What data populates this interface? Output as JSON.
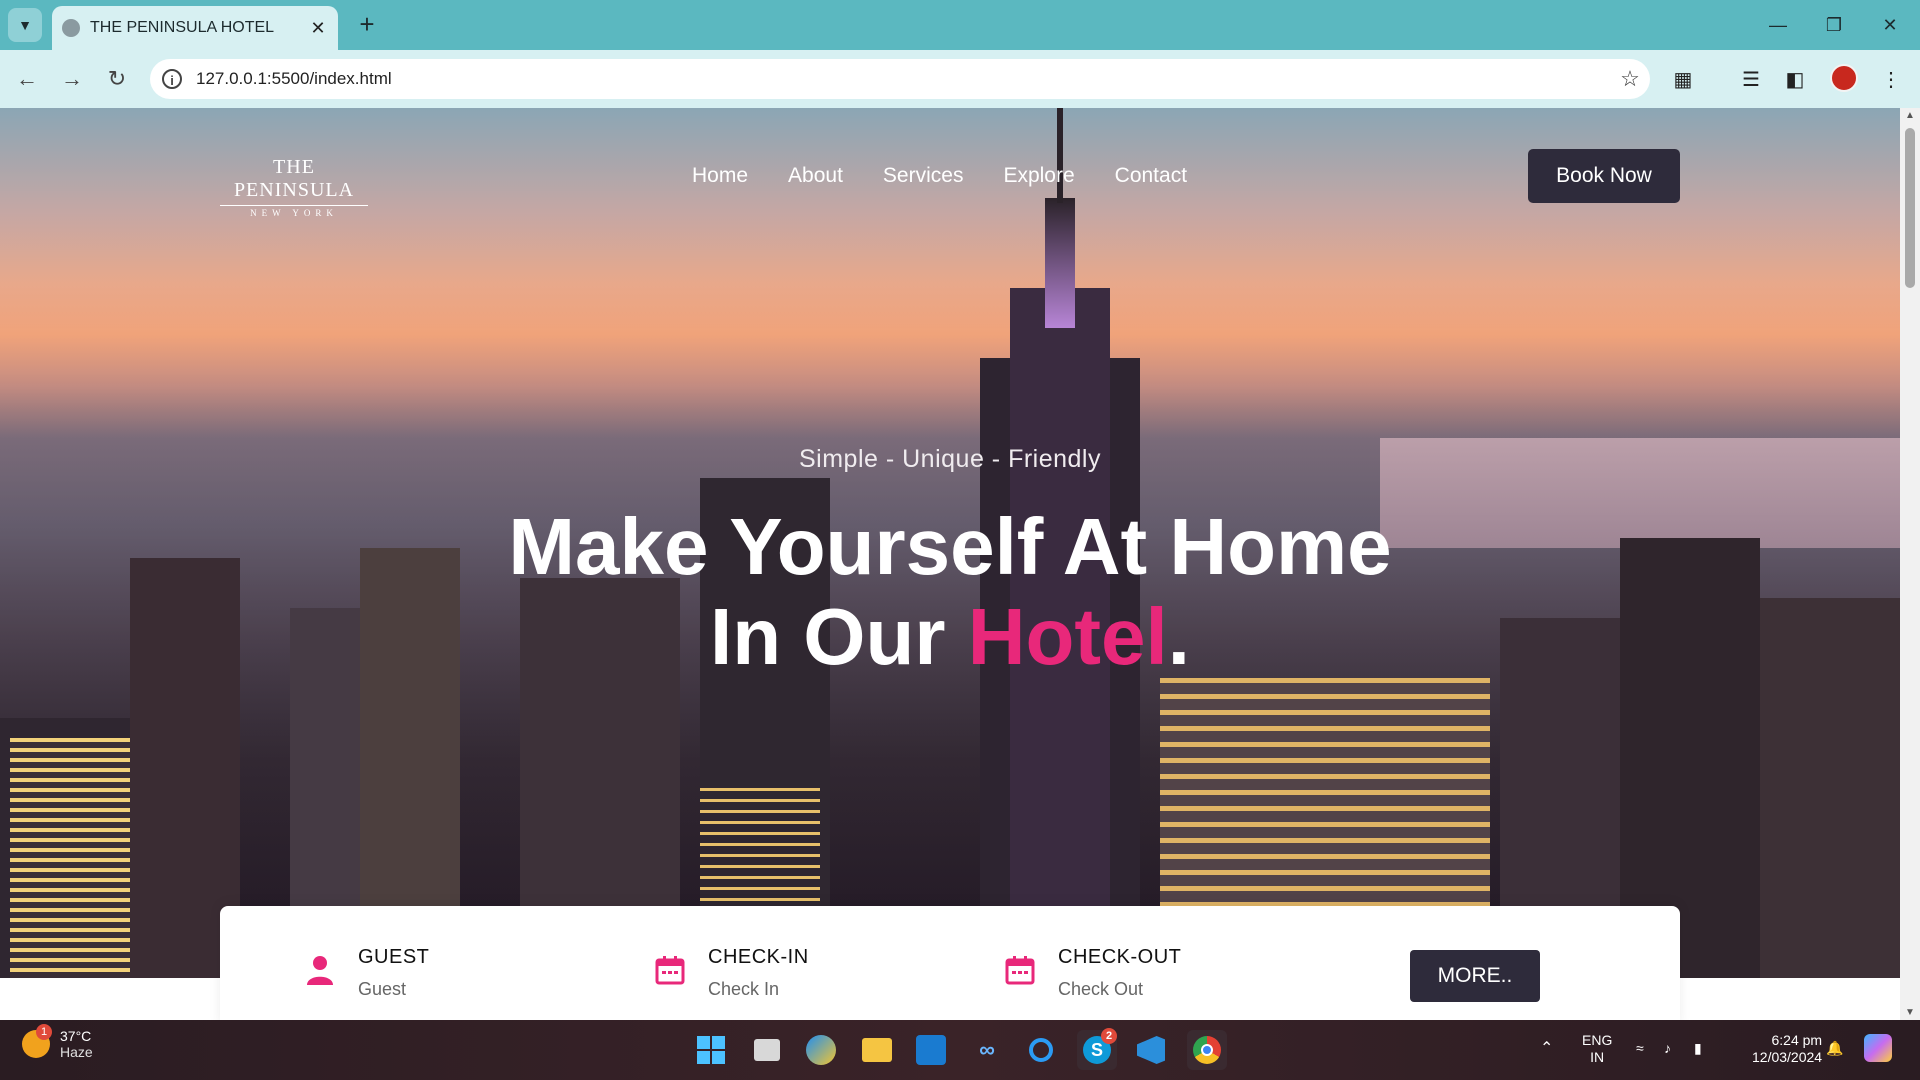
{
  "browser": {
    "tab_title": "THE PENINSULA HOTEL",
    "url": "127.0.0.1:5500/index.html"
  },
  "site": {
    "logo_line1": "THE PENINSULA",
    "logo_line2": "NEW YORK",
    "nav": [
      "Home",
      "About",
      "Services",
      "Explore",
      "Contact"
    ],
    "book_button": "Book Now",
    "tagline": "Simple - Unique - Friendly",
    "headline_line1": "Make Yourself At Home",
    "headline_line2_prefix": "In Our ",
    "headline_accent": "Hotel",
    "headline_suffix": ".",
    "accent_color": "#e8287a",
    "button_color": "#2e2b3b"
  },
  "booking": {
    "guest_label": "GUEST",
    "guest_value": "Guest",
    "checkin_label": "CHECK-IN",
    "checkin_value": "Check In",
    "checkout_label": "CHECK-OUT",
    "checkout_value": "Check Out",
    "more_button": "MORE.."
  },
  "taskbar": {
    "weather_badge": "1",
    "temperature": "37°C",
    "condition": "Haze",
    "skype_badge": "2",
    "lang_line1": "ENG",
    "lang_line2": "IN",
    "time": "6:24 pm",
    "date": "12/03/2024"
  }
}
